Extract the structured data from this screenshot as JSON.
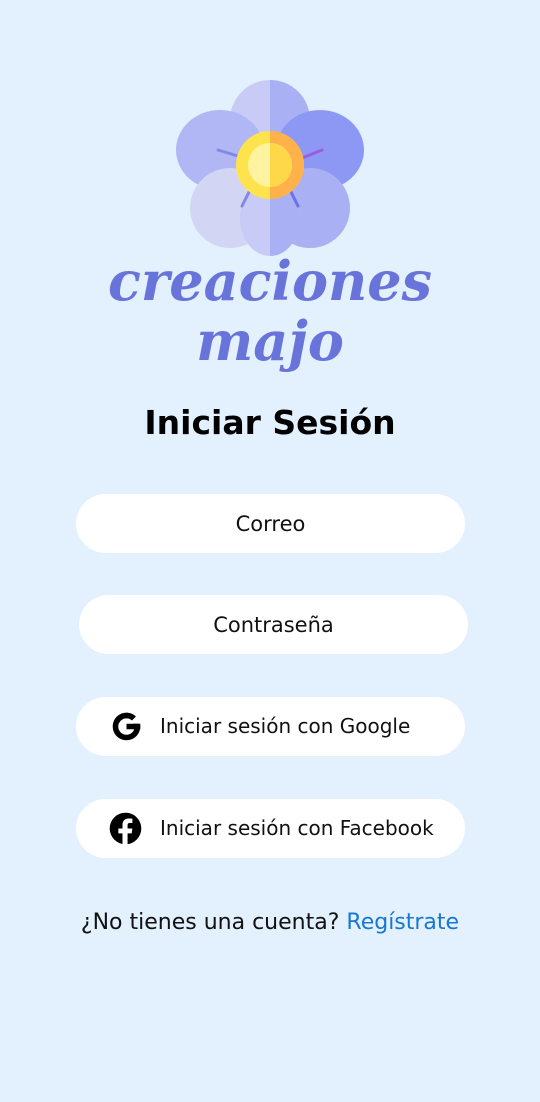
{
  "logo": {
    "brand_line1": "creaciones",
    "brand_line2": "majo",
    "icon": "flower-logo-icon"
  },
  "title": "Iniciar Sesión",
  "form": {
    "email_placeholder": "Correo",
    "password_placeholder": "Contraseña"
  },
  "social": {
    "google_label": "Iniciar sesión con Google",
    "google_icon": "google-icon",
    "facebook_label": "Iniciar sesión con Facebook",
    "facebook_icon": "facebook-icon"
  },
  "signup": {
    "prompt": "¿No tienes una cuenta?",
    "link": "Regístrate"
  },
  "colors": {
    "background": "#E3F0FE",
    "brand": "#6874D9",
    "link": "#1877D2"
  }
}
